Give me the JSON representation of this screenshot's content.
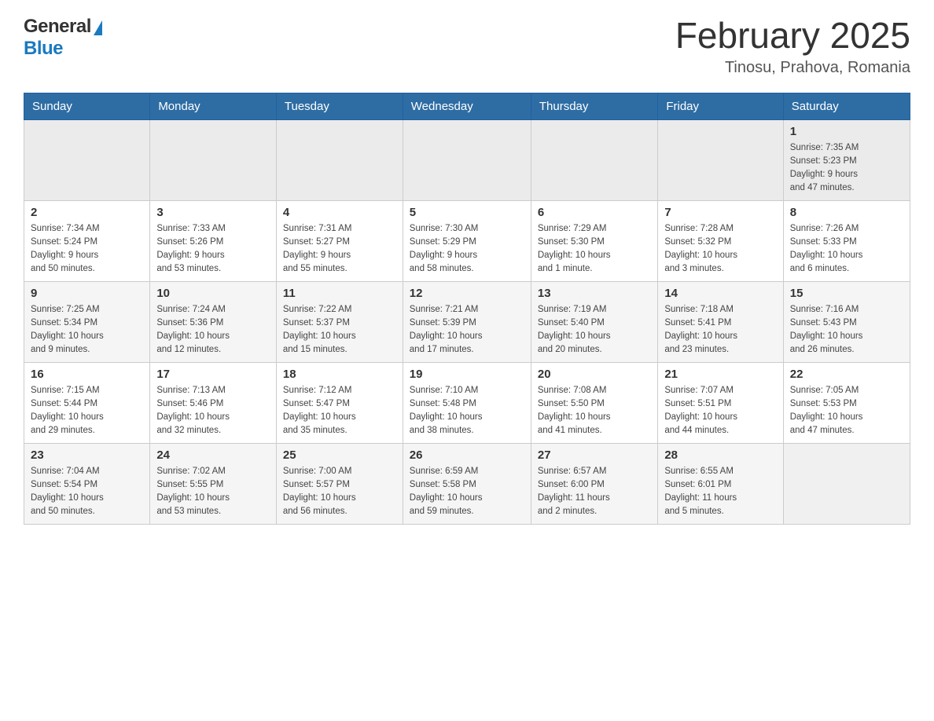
{
  "header": {
    "logo_general": "General",
    "logo_blue": "Blue",
    "month_title": "February 2025",
    "location": "Tinosu, Prahova, Romania"
  },
  "days_of_week": [
    "Sunday",
    "Monday",
    "Tuesday",
    "Wednesday",
    "Thursday",
    "Friday",
    "Saturday"
  ],
  "weeks": [
    {
      "days": [
        {
          "number": "",
          "info": ""
        },
        {
          "number": "",
          "info": ""
        },
        {
          "number": "",
          "info": ""
        },
        {
          "number": "",
          "info": ""
        },
        {
          "number": "",
          "info": ""
        },
        {
          "number": "",
          "info": ""
        },
        {
          "number": "1",
          "info": "Sunrise: 7:35 AM\nSunset: 5:23 PM\nDaylight: 9 hours\nand 47 minutes."
        }
      ]
    },
    {
      "days": [
        {
          "number": "2",
          "info": "Sunrise: 7:34 AM\nSunset: 5:24 PM\nDaylight: 9 hours\nand 50 minutes."
        },
        {
          "number": "3",
          "info": "Sunrise: 7:33 AM\nSunset: 5:26 PM\nDaylight: 9 hours\nand 53 minutes."
        },
        {
          "number": "4",
          "info": "Sunrise: 7:31 AM\nSunset: 5:27 PM\nDaylight: 9 hours\nand 55 minutes."
        },
        {
          "number": "5",
          "info": "Sunrise: 7:30 AM\nSunset: 5:29 PM\nDaylight: 9 hours\nand 58 minutes."
        },
        {
          "number": "6",
          "info": "Sunrise: 7:29 AM\nSunset: 5:30 PM\nDaylight: 10 hours\nand 1 minute."
        },
        {
          "number": "7",
          "info": "Sunrise: 7:28 AM\nSunset: 5:32 PM\nDaylight: 10 hours\nand 3 minutes."
        },
        {
          "number": "8",
          "info": "Sunrise: 7:26 AM\nSunset: 5:33 PM\nDaylight: 10 hours\nand 6 minutes."
        }
      ]
    },
    {
      "days": [
        {
          "number": "9",
          "info": "Sunrise: 7:25 AM\nSunset: 5:34 PM\nDaylight: 10 hours\nand 9 minutes."
        },
        {
          "number": "10",
          "info": "Sunrise: 7:24 AM\nSunset: 5:36 PM\nDaylight: 10 hours\nand 12 minutes."
        },
        {
          "number": "11",
          "info": "Sunrise: 7:22 AM\nSunset: 5:37 PM\nDaylight: 10 hours\nand 15 minutes."
        },
        {
          "number": "12",
          "info": "Sunrise: 7:21 AM\nSunset: 5:39 PM\nDaylight: 10 hours\nand 17 minutes."
        },
        {
          "number": "13",
          "info": "Sunrise: 7:19 AM\nSunset: 5:40 PM\nDaylight: 10 hours\nand 20 minutes."
        },
        {
          "number": "14",
          "info": "Sunrise: 7:18 AM\nSunset: 5:41 PM\nDaylight: 10 hours\nand 23 minutes."
        },
        {
          "number": "15",
          "info": "Sunrise: 7:16 AM\nSunset: 5:43 PM\nDaylight: 10 hours\nand 26 minutes."
        }
      ]
    },
    {
      "days": [
        {
          "number": "16",
          "info": "Sunrise: 7:15 AM\nSunset: 5:44 PM\nDaylight: 10 hours\nand 29 minutes."
        },
        {
          "number": "17",
          "info": "Sunrise: 7:13 AM\nSunset: 5:46 PM\nDaylight: 10 hours\nand 32 minutes."
        },
        {
          "number": "18",
          "info": "Sunrise: 7:12 AM\nSunset: 5:47 PM\nDaylight: 10 hours\nand 35 minutes."
        },
        {
          "number": "19",
          "info": "Sunrise: 7:10 AM\nSunset: 5:48 PM\nDaylight: 10 hours\nand 38 minutes."
        },
        {
          "number": "20",
          "info": "Sunrise: 7:08 AM\nSunset: 5:50 PM\nDaylight: 10 hours\nand 41 minutes."
        },
        {
          "number": "21",
          "info": "Sunrise: 7:07 AM\nSunset: 5:51 PM\nDaylight: 10 hours\nand 44 minutes."
        },
        {
          "number": "22",
          "info": "Sunrise: 7:05 AM\nSunset: 5:53 PM\nDaylight: 10 hours\nand 47 minutes."
        }
      ]
    },
    {
      "days": [
        {
          "number": "23",
          "info": "Sunrise: 7:04 AM\nSunset: 5:54 PM\nDaylight: 10 hours\nand 50 minutes."
        },
        {
          "number": "24",
          "info": "Sunrise: 7:02 AM\nSunset: 5:55 PM\nDaylight: 10 hours\nand 53 minutes."
        },
        {
          "number": "25",
          "info": "Sunrise: 7:00 AM\nSunset: 5:57 PM\nDaylight: 10 hours\nand 56 minutes."
        },
        {
          "number": "26",
          "info": "Sunrise: 6:59 AM\nSunset: 5:58 PM\nDaylight: 10 hours\nand 59 minutes."
        },
        {
          "number": "27",
          "info": "Sunrise: 6:57 AM\nSunset: 6:00 PM\nDaylight: 11 hours\nand 2 minutes."
        },
        {
          "number": "28",
          "info": "Sunrise: 6:55 AM\nSunset: 6:01 PM\nDaylight: 11 hours\nand 5 minutes."
        },
        {
          "number": "",
          "info": ""
        }
      ]
    }
  ]
}
